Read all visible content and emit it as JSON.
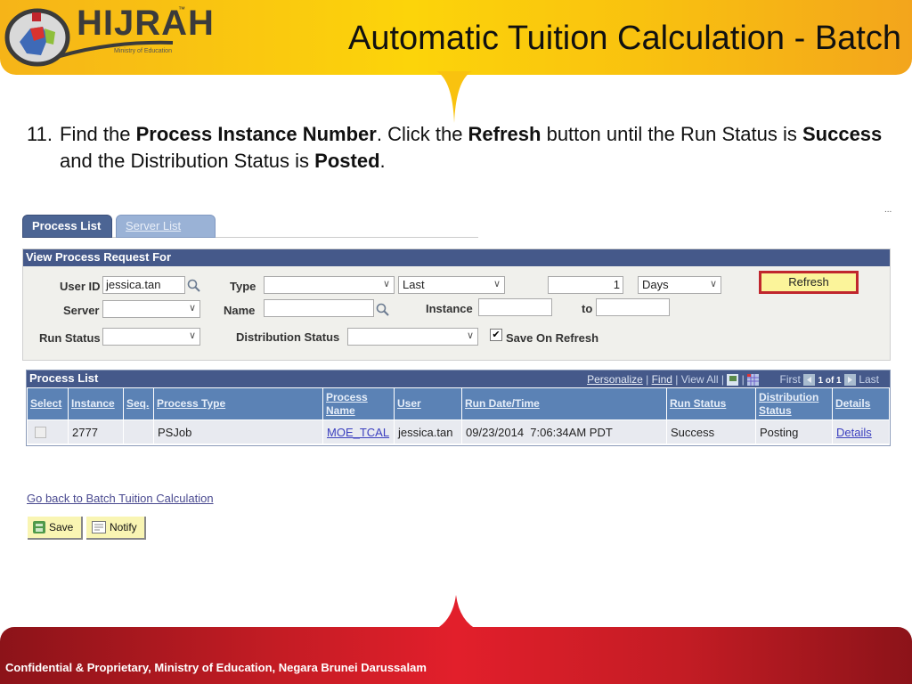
{
  "slide": {
    "logo_text": "HIJRAH",
    "logo_tm": "™",
    "logo_subtitle": "Ministry of Education",
    "title": "Automatic Tuition Calculation - Batch",
    "instruction": {
      "number": "11.",
      "parts": [
        {
          "text": "Find the ",
          "bold": false
        },
        {
          "text": "Process Instance Number",
          "bold": true
        },
        {
          "text": ". Click the ",
          "bold": false
        },
        {
          "text": "Refresh",
          "bold": true
        },
        {
          "text": " button until the Run Status is ",
          "bold": false
        },
        {
          "text": "Success",
          "bold": true
        },
        {
          "text": " and the Distribution Status is ",
          "bold": false
        },
        {
          "text": "Posted",
          "bold": true
        },
        {
          "text": ".",
          "bold": false
        }
      ]
    },
    "footer": "Confidential & Proprietary, Ministry of Education, Negara Brunei Darussalam"
  },
  "tabs": [
    {
      "label": "Process List",
      "active": true
    },
    {
      "label": "Server List",
      "active": false
    }
  ],
  "ellipsis": "...",
  "view_request": {
    "heading": "View Process Request For",
    "user_id_label": "User ID",
    "user_id_value": "jessica.tan",
    "type_label": "Type",
    "type_value": "",
    "period_value": "Last",
    "count_value": "1",
    "unit_value": "Days",
    "refresh_label": "Refresh",
    "server_label": "Server",
    "server_value": "",
    "name_label": "Name",
    "name_value": "",
    "instance_label": "Instance",
    "instance_from": "",
    "to_label": "to",
    "instance_to": "",
    "run_status_label": "Run Status",
    "run_status_value": "",
    "dist_status_label": "Distribution Status",
    "dist_status_value": "",
    "save_on_refresh_label": "Save On Refresh",
    "save_on_refresh_checked": true
  },
  "process_list": {
    "heading": "Process List",
    "tools": {
      "personalize": "Personalize",
      "find": "Find",
      "view_all": "View All",
      "first": "First",
      "page": "1 of 1",
      "last": "Last"
    },
    "columns": [
      "Select",
      "Instance",
      "Seq.",
      "Process Type",
      "Process Name",
      "User",
      "Run Date/Time",
      "Run Status",
      "Distribution Status",
      "Details"
    ],
    "rows": [
      {
        "select": false,
        "instance": "2777",
        "seq": "",
        "process_type": "PSJob",
        "process_name": "MOE_TCAL",
        "user": "jessica.tan",
        "run_datetime": "09/23/2014  7:06:34AM PDT",
        "run_status": "Success",
        "distribution_status": "Posting",
        "details": "Details"
      }
    ]
  },
  "back_link": "Go back to Batch Tuition Calculation",
  "buttons": {
    "save": "Save",
    "notify": "Notify"
  },
  "colors": {
    "header_yellow": "#fcd40a",
    "footer_red": "#e21f2b",
    "panel_navy": "#45598a",
    "refresh_border": "#c0262d"
  }
}
